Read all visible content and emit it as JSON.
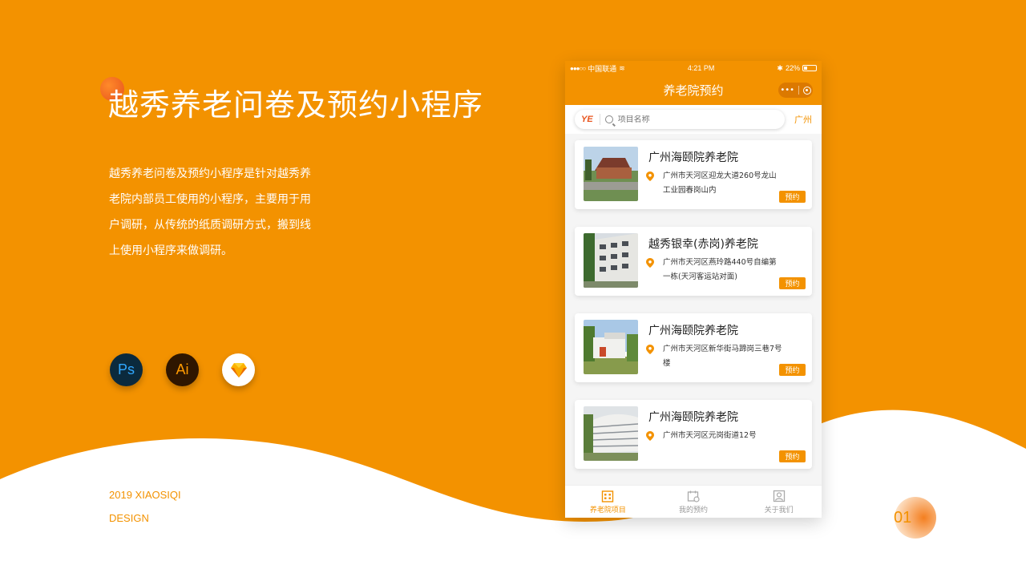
{
  "slide": {
    "title": "越秀养老问卷及预约小程序",
    "description": "越秀养老问卷及预约小程序是针对越秀养老院内部员工使用的小程序，主要用于用户调研，从传统的纸质调研方式，搬到线上使用小程序来做调研。",
    "tools": [
      {
        "label": "Ps",
        "icon": "photoshop-icon"
      },
      {
        "label": "Ai",
        "icon": "illustrator-icon"
      },
      {
        "label": "",
        "icon": "sketch-icon"
      }
    ],
    "footer_year": "2019 XIAOSIQI",
    "footer_design": "DESIGN",
    "page_number": "01",
    "colors": {
      "brand_orange": "#f39200",
      "accent_red": "#e8531c"
    }
  },
  "phone": {
    "status": {
      "carrier": "中国联通",
      "time": "4:21 PM",
      "battery": "22%"
    },
    "nav_title": "养老院预约",
    "capsule_more": "•••",
    "search": {
      "logo": "YE",
      "placeholder": "项目名称",
      "city": "广州"
    },
    "book_label": "预约",
    "cards": [
      {
        "name": "广州海颐院养老院",
        "address": "广州市天河区迎龙大道260号龙山工业园春岗山内"
      },
      {
        "name": "越秀银幸(赤岗)养老院",
        "address": "广州市天河区燕玲路440号自编第一栋(天河客运站对面)"
      },
      {
        "name": "广州海颐院养老院",
        "address": "广州市天河区新华街马蹄岗三巷7号楼"
      },
      {
        "name": "广州海颐院养老院",
        "address": "广州市天河区元岗街道12号"
      }
    ],
    "tabs": [
      {
        "label": "养老院项目",
        "active": true,
        "icon": "building-icon"
      },
      {
        "label": "我的预约",
        "active": false,
        "icon": "calendar-icon"
      },
      {
        "label": "关于我们",
        "active": false,
        "icon": "user-icon"
      }
    ]
  }
}
